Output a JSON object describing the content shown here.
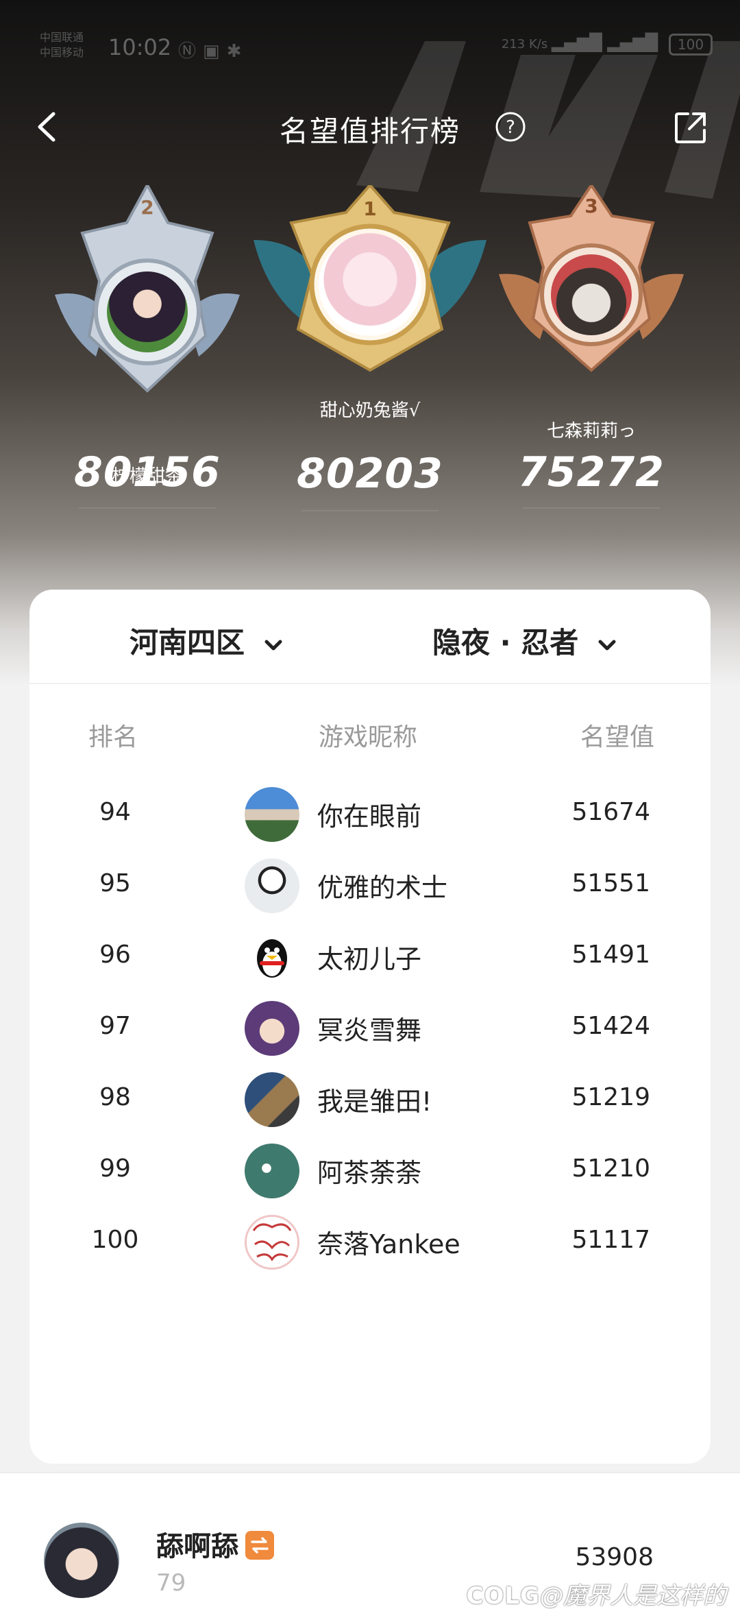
{
  "status_bar": {
    "carrier_line1": "中国联通",
    "carrier_line2": "中国移动",
    "time": "10:02",
    "net_speed": "213 K/s",
    "battery": "100"
  },
  "header": {
    "title": "名望值排行榜"
  },
  "podium": [
    {
      "place": "2",
      "name": "柠檬甜茶",
      "score": "80156"
    },
    {
      "place": "1",
      "name": "甜心奶兔酱√",
      "score": "80203"
    },
    {
      "place": "3",
      "name": "七森莉莉っ",
      "score": "75272"
    }
  ],
  "filters": {
    "server": "河南四区",
    "job": "隐夜 · 忍者"
  },
  "table": {
    "columns": [
      "排名",
      "游戏昵称",
      "名望值"
    ],
    "rows": [
      {
        "rank": "94",
        "name": "你在眼前",
        "value": "51674"
      },
      {
        "rank": "95",
        "name": "优雅的术士",
        "value": "51551"
      },
      {
        "rank": "96",
        "name": "太初儿子",
        "value": "51491"
      },
      {
        "rank": "97",
        "name": "冥炎雪舞",
        "value": "51424"
      },
      {
        "rank": "98",
        "name": "我是雏田!",
        "value": "51219"
      },
      {
        "rank": "99",
        "name": "阿茶荼荼",
        "value": "51210"
      },
      {
        "rank": "100",
        "name": "奈落Yankee",
        "value": "51117"
      }
    ]
  },
  "me": {
    "name": "舔啊舔",
    "rank": "79",
    "score": "53908"
  },
  "watermark": {
    "logo": "COLG",
    "text": "@魔界人是这样的"
  },
  "colors": {
    "gold": "#e3c27a",
    "silver": "#b9c3cf",
    "bronze": "#d79a78",
    "accent_orange": "#f08a3c"
  }
}
